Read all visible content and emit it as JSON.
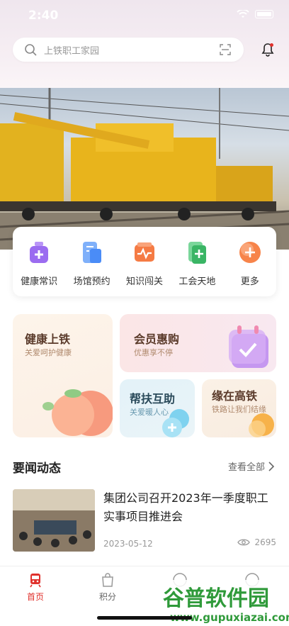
{
  "status": {
    "time": "2:40"
  },
  "search": {
    "placeholder": "上铁职工家园"
  },
  "quick_actions": [
    {
      "label": "健康常识",
      "icon": "health-bottle-icon",
      "color": "#9b6cf0"
    },
    {
      "label": "场馆预约",
      "icon": "venue-booking-icon",
      "color": "#4a8cf7"
    },
    {
      "label": "知识闯关",
      "icon": "knowledge-chart-icon",
      "color": "#f57b44"
    },
    {
      "label": "工会天地",
      "icon": "union-folder-icon",
      "color": "#3ab565"
    },
    {
      "label": "更多",
      "icon": "more-plus-icon",
      "color": "#f7844a"
    }
  ],
  "cards": {
    "health": {
      "title": "健康上铁",
      "subtitle": "关爱呵护健康"
    },
    "member": {
      "title": "会员惠购",
      "subtitle": "优惠享不停"
    },
    "help": {
      "title": "帮扶互助",
      "subtitle": "关爱暖人心"
    },
    "fate": {
      "title": "缘在高铁",
      "subtitle": "铁路让我们结缘"
    }
  },
  "news": {
    "heading": "要闻动态",
    "more_label": "查看全部",
    "items": [
      {
        "title": "集团公司召开2023年一季度职工实事项目推进会",
        "date": "2023-05-12",
        "views": "2695"
      }
    ]
  },
  "tabbar": [
    {
      "label": "首页",
      "icon": "train-home-icon",
      "active": true
    },
    {
      "label": "积分",
      "icon": "points-bag-icon",
      "active": false
    },
    {
      "label": "",
      "icon": "discover-icon",
      "active": false
    },
    {
      "label": "",
      "icon": "profile-icon",
      "active": false
    }
  ],
  "watermark": {
    "text": "谷普软件园",
    "url": "www.gupuxiazai.com"
  },
  "colors": {
    "accent": "#e0312c"
  }
}
